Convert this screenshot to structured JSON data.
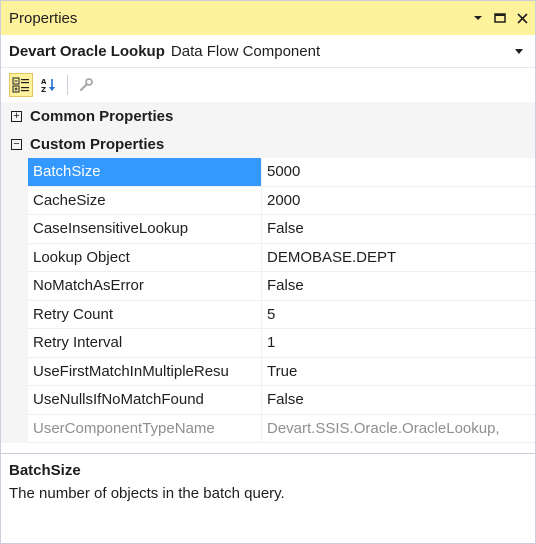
{
  "window": {
    "title": "Properties"
  },
  "object_selector": {
    "name": "Devart Oracle Lookup",
    "type": "Data Flow Component"
  },
  "toolbar": {
    "buttons": [
      {
        "icon": "categorized-icon",
        "active": true
      },
      {
        "icon": "alphabetical-icon",
        "active": false
      },
      {
        "icon": "property-pages-icon",
        "active": false
      }
    ]
  },
  "categories": [
    {
      "label": "Common Properties",
      "expanded": false
    },
    {
      "label": "Custom Properties",
      "expanded": true
    }
  ],
  "properties": [
    {
      "name": "BatchSize",
      "value": "5000"
    },
    {
      "name": "CacheSize",
      "value": "2000"
    },
    {
      "name": "CaseInsensitiveLookup",
      "value": "False"
    },
    {
      "name": "Lookup Object",
      "value": "DEMOBASE.DEPT"
    },
    {
      "name": "NoMatchAsError",
      "value": "False"
    },
    {
      "name": "Retry Count",
      "value": "5"
    },
    {
      "name": "Retry Interval",
      "value": "1"
    },
    {
      "name": "UseFirstMatchInMultipleResu",
      "value": "True"
    },
    {
      "name": "UseNullsIfNoMatchFound",
      "value": "False"
    },
    {
      "name": "UserComponentTypeName",
      "value": "Devart.SSIS.Oracle.OracleLookup,"
    }
  ],
  "selected_index": 0,
  "description": {
    "title": "BatchSize",
    "text": "The number of objects in the batch query."
  },
  "colors": {
    "title_bar": "#fff29d",
    "selection": "#3399ff",
    "readonly_text": "#8f8f8f"
  }
}
